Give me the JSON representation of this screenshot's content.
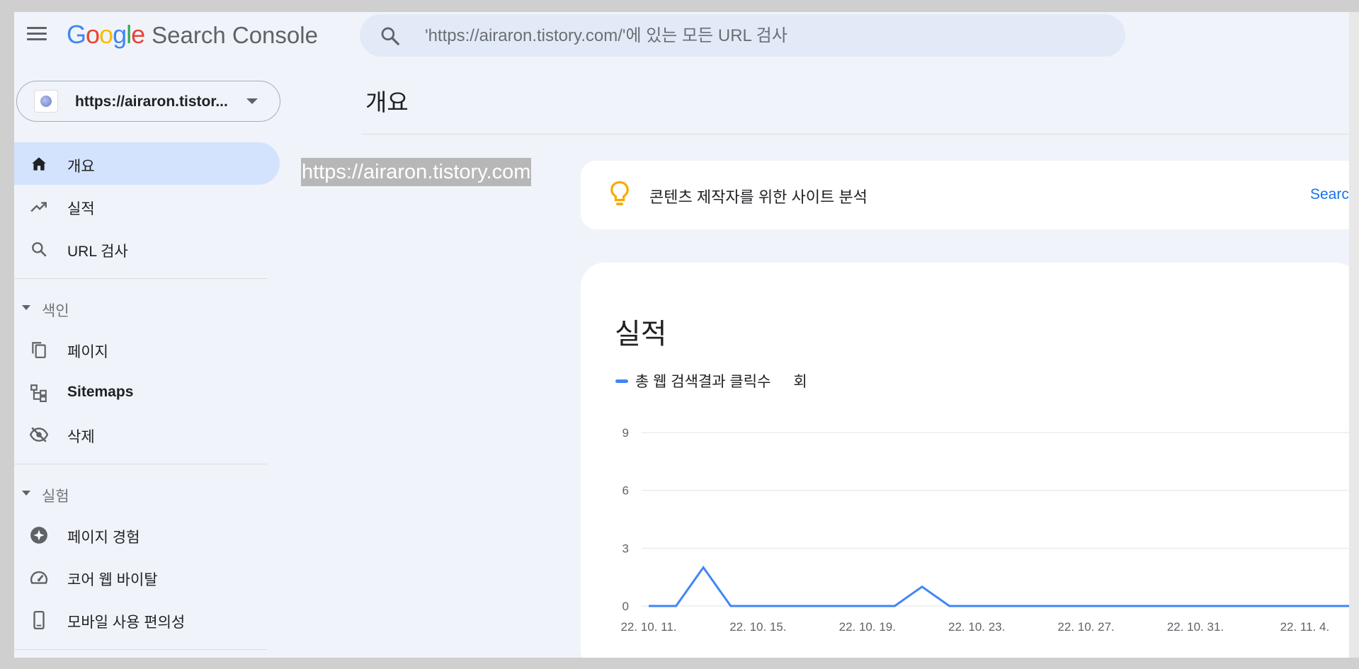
{
  "header": {
    "logo_text": "Google",
    "product_name": "Search Console",
    "search_placeholder": "'https://airaron.tistory.com/'에 있는 모든 URL 검사"
  },
  "property": {
    "label": "https://airaron.tistor..."
  },
  "sidebar": {
    "items": [
      {
        "label": "개요",
        "icon": "home-icon",
        "active": true
      },
      {
        "label": "실적",
        "icon": "trending-up-icon"
      },
      {
        "label": "URL 검사",
        "icon": "search-icon"
      }
    ],
    "sections": [
      {
        "label": "색인",
        "items": [
          {
            "label": "페이지",
            "icon": "pages-icon"
          },
          {
            "label": "Sitemaps",
            "icon": "sitemap-icon"
          },
          {
            "label": "삭제",
            "icon": "eye-off-icon"
          }
        ]
      },
      {
        "label": "실험",
        "items": [
          {
            "label": "페이지 경험",
            "icon": "star-badge-icon"
          },
          {
            "label": "코어 웹 바이탈",
            "icon": "speedometer-icon"
          },
          {
            "label": "모바일 사용 편의성",
            "icon": "phone-icon"
          }
        ]
      }
    ]
  },
  "main": {
    "page_title": "개요",
    "url_label": "https://airaron.tistory.com",
    "insight": {
      "text": "콘텐츠 제작자를 위한 사이트 분석",
      "link": "Search"
    },
    "performance": {
      "title": "실적",
      "legend_label": "총 웹 검색결과 클릭수",
      "legend_unit": "회"
    }
  },
  "colors": {
    "accent": "#1a73e8",
    "line": "#4285f4",
    "nav_active": "#d3e3fd",
    "background": "#f0f4fa"
  },
  "chart_data": {
    "type": "line",
    "title": "",
    "xlabel": "",
    "ylabel": "",
    "ylim": [
      0,
      9
    ],
    "yticks": [
      0,
      3,
      6,
      9
    ],
    "xtick_labels": [
      "22. 10. 11.",
      "22. 10. 15.",
      "22. 10. 19.",
      "22. 10. 23.",
      "22. 10. 27.",
      "22. 10. 31.",
      "22. 11. 4."
    ],
    "x": [
      "2022-10-11",
      "2022-10-12",
      "2022-10-13",
      "2022-10-14",
      "2022-10-15",
      "2022-10-16",
      "2022-10-17",
      "2022-10-18",
      "2022-10-19",
      "2022-10-20",
      "2022-10-21",
      "2022-10-22",
      "2022-10-23",
      "2022-10-24",
      "2022-10-25",
      "2022-10-26",
      "2022-10-27",
      "2022-10-28",
      "2022-10-29",
      "2022-10-30",
      "2022-10-31",
      "2022-11-01",
      "2022-11-02",
      "2022-11-03",
      "2022-11-04",
      "2022-11-05",
      "2022-11-06"
    ],
    "series": [
      {
        "name": "총 웹 검색결과 클릭수",
        "values": [
          0,
          0,
          2,
          0,
          0,
          0,
          0,
          0,
          0,
          0,
          1,
          0,
          0,
          0,
          0,
          0,
          0,
          0,
          0,
          0,
          0,
          0,
          0,
          0,
          0,
          0,
          0
        ]
      }
    ],
    "grid": true
  }
}
